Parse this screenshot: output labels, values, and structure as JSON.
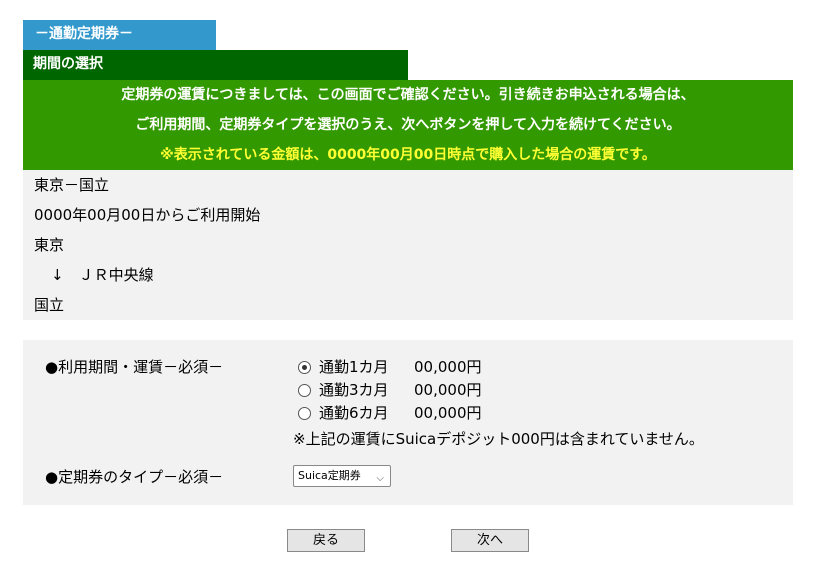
{
  "header": {
    "tab_title": "－通勤定期券－"
  },
  "section": {
    "title": "期間の選択"
  },
  "notice": {
    "line1": "定期券の運賃につきましては、この画面でご確認ください。引き続きお申込される場合は、",
    "line2": "ご利用期間、定期券タイプを選択のうえ、次へボタンを押して入力を続けてください。",
    "line3": "※表示されている金額は、0000年00月00日時点で購入した場合の運賃です。"
  },
  "route": {
    "section_name": "東京－国立",
    "start_text": "0000年00月00日からご利用開始",
    "from": "東京",
    "via": "↓　ＪＲ中央線",
    "to": "国立"
  },
  "form": {
    "period_label": "●利用期間・運賃－必須－",
    "options": [
      {
        "label": "通勤1カ月",
        "price": "00,000円",
        "checked": true
      },
      {
        "label": "通勤3カ月",
        "price": "00,000円",
        "checked": false
      },
      {
        "label": "通勤6カ月",
        "price": "00,000円",
        "checked": false
      }
    ],
    "note": "※上記の運賃にSuicaデポジット000円は含まれていません。",
    "type_label": "●定期券のタイプ－必須－",
    "type_selected": "Suica定期券"
  },
  "buttons": {
    "back": "戻る",
    "next": "次へ"
  },
  "colors": {
    "tab": "#3399cc",
    "section": "#006600",
    "notice": "#339900",
    "warn": "#ffff33",
    "panel": "#f2f2f2"
  }
}
